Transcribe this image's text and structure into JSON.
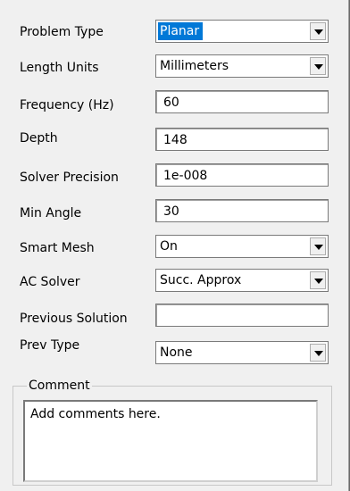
{
  "problem_type": {
    "label": "Problem Type",
    "value": "Planar"
  },
  "length_units": {
    "label": "Length Units",
    "value": "Millimeters"
  },
  "frequency": {
    "label": "Frequency (Hz)",
    "value": "60"
  },
  "depth": {
    "label": "Depth",
    "value": "148"
  },
  "solver_precision": {
    "label": "Solver Precision",
    "value": "1e-008"
  },
  "min_angle": {
    "label": "Min Angle",
    "value": "30"
  },
  "smart_mesh": {
    "label": "Smart Mesh",
    "value": "On"
  },
  "ac_solver": {
    "label": "AC Solver",
    "value": "Succ. Approx"
  },
  "previous_solution": {
    "label": "Previous Solution",
    "value": ""
  },
  "prev_type": {
    "label": "Prev Type",
    "value": "None"
  },
  "comment": {
    "title": "Comment",
    "value": "Add comments here."
  },
  "colors": {
    "selection": "#0078d7",
    "background": "#f0f0f0"
  },
  "icons": {
    "dropdown": "chevron-down-icon"
  }
}
